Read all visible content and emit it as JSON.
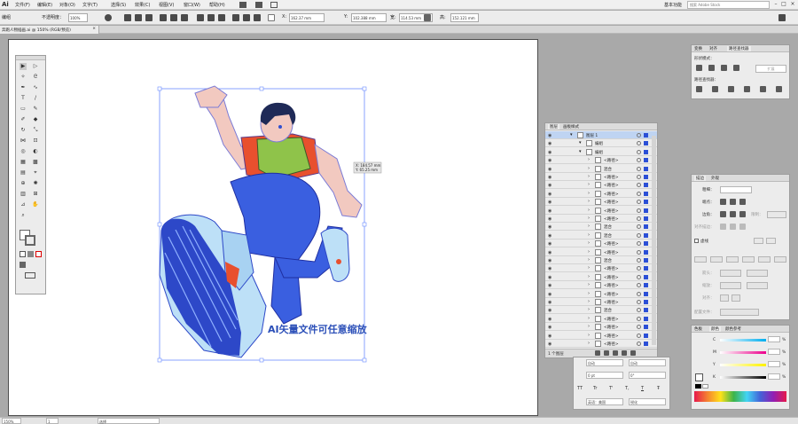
{
  "menubar": {
    "logo": "Ai",
    "items": [
      "文件(F)",
      "编辑(E)",
      "对象(O)",
      "文字(T)",
      "选择(S)",
      "效果(C)",
      "视图(V)",
      "窗口(W)",
      "帮助(H)"
    ],
    "workspace": "基本功能",
    "search_placeholder": "搜索 Adobe Stock"
  },
  "control_bar": {
    "label": "编组",
    "opacity_label": "不透明度：",
    "opacity_value": "100%",
    "x_label": "X:",
    "x_value": "162.37 mm",
    "y_label": "Y:",
    "y_value": "102.388 mm",
    "w_label": "宽:",
    "w_value": "114.53 mm",
    "h_label": "高:",
    "h_value": "152.121 mm"
  },
  "document_tab": {
    "title": "奔跑人物插画.ai @ 150% (RGB/预览)",
    "close": "×"
  },
  "canvas": {
    "caption": "AI矢量文件可任意缩放",
    "readout_x": "X: 184.57 mm",
    "readout_y": "Y: 65.25 mm"
  },
  "layers_panel": {
    "tabs": [
      "图层",
      "画板样式"
    ],
    "rows": [
      {
        "name": "图层 1",
        "indent": 0,
        "selected": true
      },
      {
        "name": "编组",
        "indent": 1,
        "selected": false
      },
      {
        "name": "编组",
        "indent": 1,
        "selected": false
      },
      {
        "name": "<路径>",
        "indent": 2,
        "selected": false
      },
      {
        "name": "混合",
        "indent": 2,
        "selected": false
      },
      {
        "name": "<路径>",
        "indent": 2,
        "selected": false
      },
      {
        "name": "<路径>",
        "indent": 2,
        "selected": false
      },
      {
        "name": "<路径>",
        "indent": 2,
        "selected": false
      },
      {
        "name": "<路径>",
        "indent": 2,
        "selected": false
      },
      {
        "name": "<路径>",
        "indent": 2,
        "selected": false
      },
      {
        "name": "<路径>",
        "indent": 2,
        "selected": false
      },
      {
        "name": "混合",
        "indent": 2,
        "selected": false
      },
      {
        "name": "混合",
        "indent": 2,
        "selected": false
      },
      {
        "name": "<路径>",
        "indent": 2,
        "selected": false
      },
      {
        "name": "<路径>",
        "indent": 2,
        "selected": false
      },
      {
        "name": "混合",
        "indent": 2,
        "selected": false
      },
      {
        "name": "<路径>",
        "indent": 2,
        "selected": false
      },
      {
        "name": "<路径>",
        "indent": 2,
        "selected": false
      },
      {
        "name": "<路径>",
        "indent": 2,
        "selected": false
      },
      {
        "name": "<路径>",
        "indent": 2,
        "selected": false
      },
      {
        "name": "<路径>",
        "indent": 2,
        "selected": false
      },
      {
        "name": "混合",
        "indent": 2,
        "selected": false
      },
      {
        "name": "<路径>",
        "indent": 2,
        "selected": false
      },
      {
        "name": "<路径>",
        "indent": 2,
        "selected": false
      },
      {
        "name": "<路径>",
        "indent": 2,
        "selected": false
      },
      {
        "name": "<路径>",
        "indent": 2,
        "selected": false
      }
    ],
    "footer": "1 个图层"
  },
  "path_panel": {
    "tabs": [
      "变换",
      "对齐",
      "路径查找器"
    ],
    "shape_modes": "形状模式：",
    "expand": "扩展",
    "pathfinders": "路径查找器："
  },
  "stroke_panel": {
    "tabs": [
      "描边",
      "外观"
    ],
    "weight_label": "粗细：",
    "cap_label": "端点：",
    "corner_label": "边角：",
    "limit_label": "限制：",
    "align_label": "对齐描边：",
    "dashed_label": "虚线",
    "arrow_label": "箭头：",
    "scale_label": "缩放：",
    "align2_label": "对齐：",
    "profile_label": "配置文件："
  },
  "color_panel": {
    "tabs": [
      "色板",
      "颜色",
      "颜色参考"
    ],
    "channels": [
      "C",
      "M",
      "Y",
      "K"
    ],
    "unit": "%"
  },
  "char_panel": {
    "auto": "自动",
    "tracking": "0 pt",
    "rotation": "0°",
    "tt_labels": [
      "TT",
      "Tr",
      "T'",
      "T,",
      "T",
      "Ŧ"
    ],
    "lang_label": "英语：美国",
    "sharp": "锐化"
  },
  "status": {
    "zoom": "150%",
    "page": "1",
    "mode": "选择"
  },
  "colors": {
    "accent": "#2b4fd6",
    "shoe_blue": "#2d48c8",
    "pants_blue": "#3a5fe0",
    "shirt_green": "#8fc34a",
    "shirt_red": "#e8502e",
    "skin": "#f2c9c0",
    "caption_blue": "#2b4fb8"
  }
}
